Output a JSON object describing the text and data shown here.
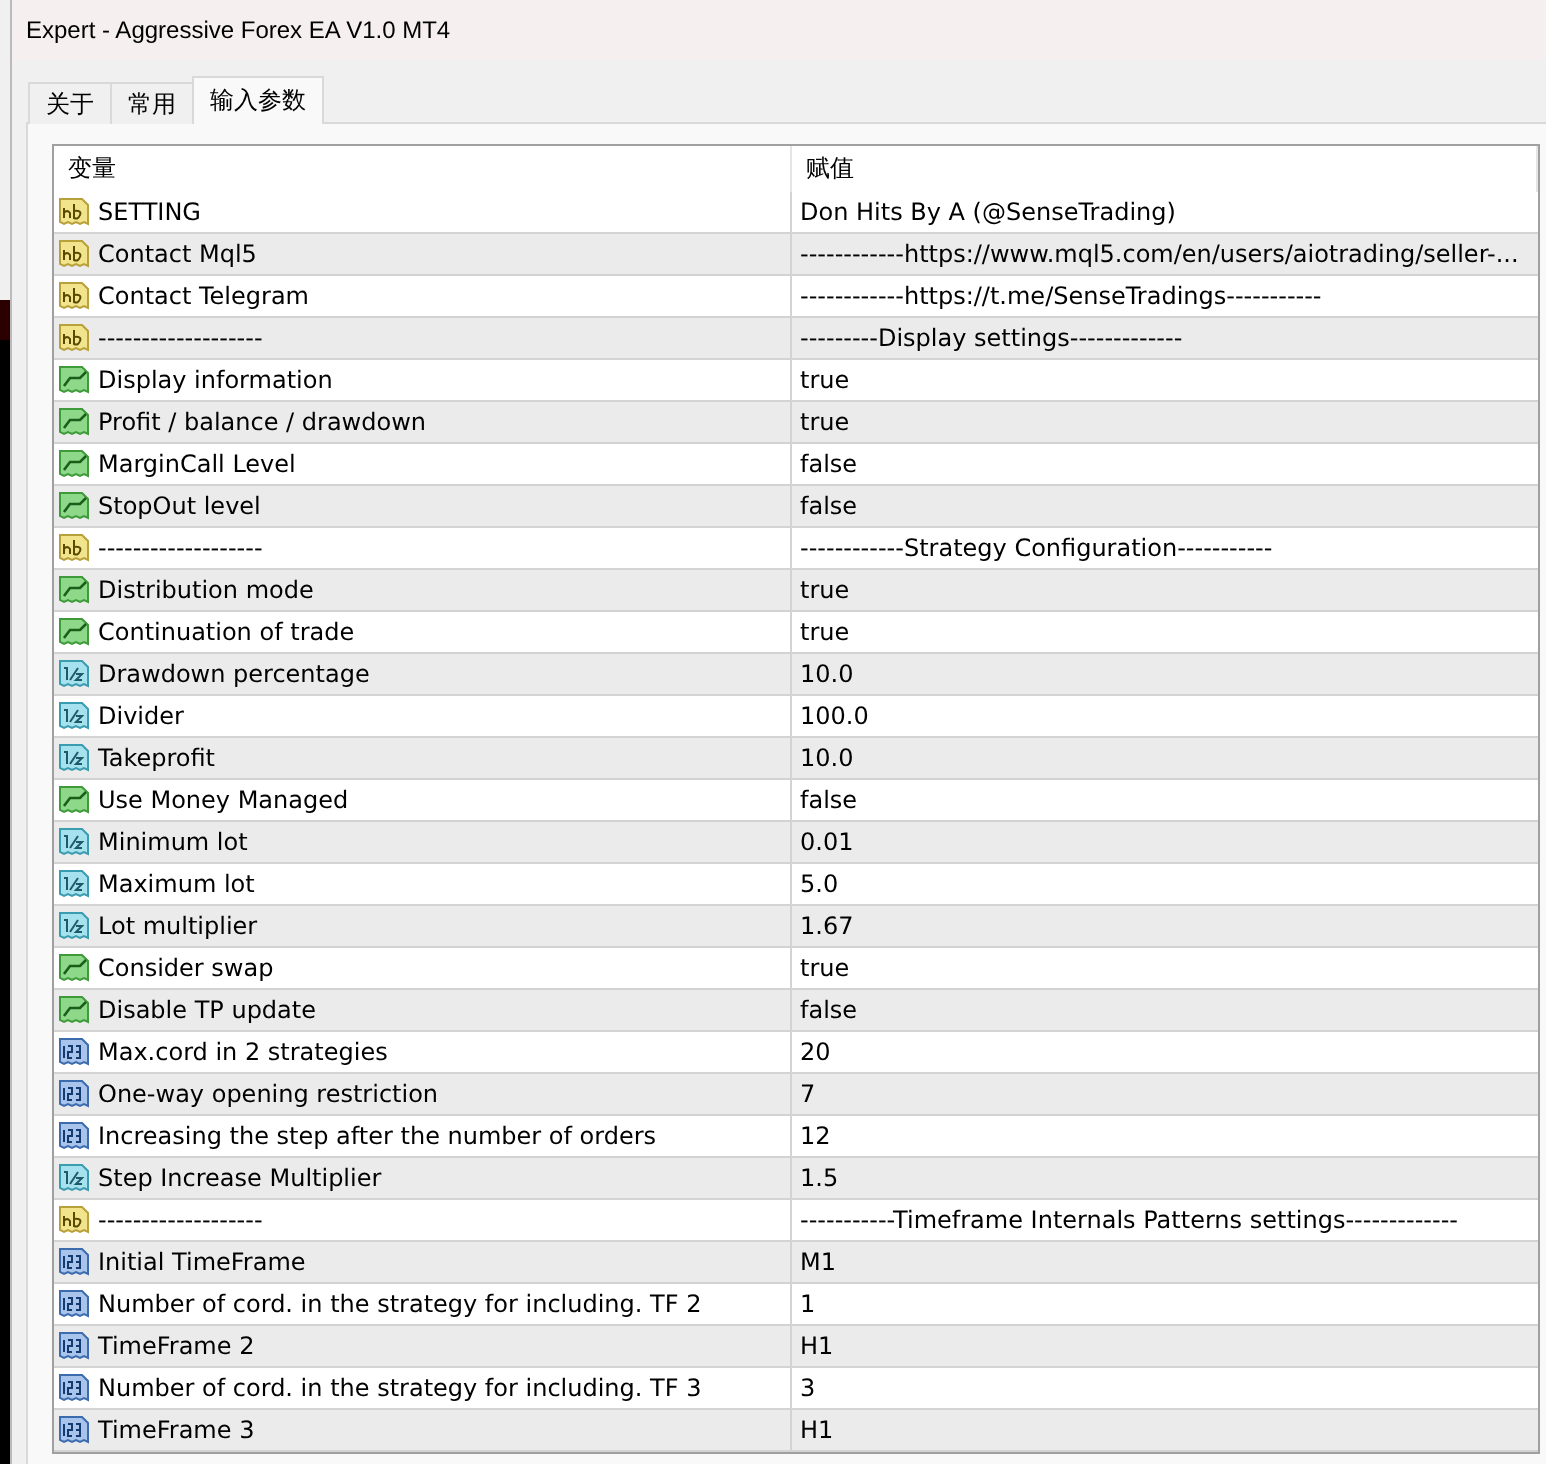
{
  "window": {
    "title": "Expert - Aggressive Forex EA V1.0 MT4"
  },
  "tabs": [
    {
      "label": "关于",
      "selected": false
    },
    {
      "label": "常用",
      "selected": false
    },
    {
      "label": "输入参数",
      "selected": true
    }
  ],
  "table": {
    "columns": [
      "变量",
      "赋值"
    ],
    "rows": [
      {
        "kind": "string",
        "name": "SETTING",
        "value": "Don Hits By A (@SenseTrading)"
      },
      {
        "kind": "string",
        "name": "Contact Mql5",
        "value": "------------https://www.mql5.com/en/users/aiotrading/seller-..."
      },
      {
        "kind": "string",
        "name": "Contact Telegram",
        "value": "------------https://t.me/SenseTradings-----------"
      },
      {
        "kind": "string",
        "name": "-------------------",
        "value": "---------Display settings-------------"
      },
      {
        "kind": "bool",
        "name": "Display information",
        "value": "true"
      },
      {
        "kind": "bool",
        "name": "Profit / balance / drawdown",
        "value": "true"
      },
      {
        "kind": "bool",
        "name": "MarginCall Level",
        "value": "false"
      },
      {
        "kind": "bool",
        "name": "StopOut level",
        "value": "false"
      },
      {
        "kind": "string",
        "name": "-------------------",
        "value": "------------Strategy Configuration-----------"
      },
      {
        "kind": "bool",
        "name": "Distribution mode",
        "value": "true"
      },
      {
        "kind": "bool",
        "name": "Continuation of trade",
        "value": "true"
      },
      {
        "kind": "double",
        "name": "Drawdown percentage",
        "value": "10.0"
      },
      {
        "kind": "double",
        "name": "Divider",
        "value": "100.0"
      },
      {
        "kind": "double",
        "name": "Takeprofit",
        "value": "10.0"
      },
      {
        "kind": "bool",
        "name": "Use Money Managed",
        "value": "false"
      },
      {
        "kind": "double",
        "name": "Minimum lot",
        "value": "0.01"
      },
      {
        "kind": "double",
        "name": "Maximum lot",
        "value": "5.0"
      },
      {
        "kind": "double",
        "name": "Lot multiplier",
        "value": "1.67"
      },
      {
        "kind": "bool",
        "name": "Consider swap",
        "value": "true"
      },
      {
        "kind": "bool",
        "name": "Disable TP update",
        "value": "false"
      },
      {
        "kind": "int",
        "name": "Max.cord in 2 strategies",
        "value": "20"
      },
      {
        "kind": "int",
        "name": "One-way opening restriction",
        "value": "7"
      },
      {
        "kind": "int",
        "name": "Increasing the step after the number of orders",
        "value": "12"
      },
      {
        "kind": "double",
        "name": "Step Increase Multiplier",
        "value": "1.5"
      },
      {
        "kind": "string",
        "name": "-------------------",
        "value": "-----------Timeframe Internals Patterns settings-------------"
      },
      {
        "kind": "int",
        "name": "Initial TimeFrame",
        "value": "M1"
      },
      {
        "kind": "int",
        "name": "Number of cord. in the strategy for including. TF 2",
        "value": "1"
      },
      {
        "kind": "int",
        "name": "TimeFrame 2",
        "value": "H1"
      },
      {
        "kind": "int",
        "name": "Number of cord. in the strategy for including. TF 3",
        "value": "3"
      },
      {
        "kind": "int",
        "name": "TimeFrame 3",
        "value": "H1"
      }
    ]
  }
}
